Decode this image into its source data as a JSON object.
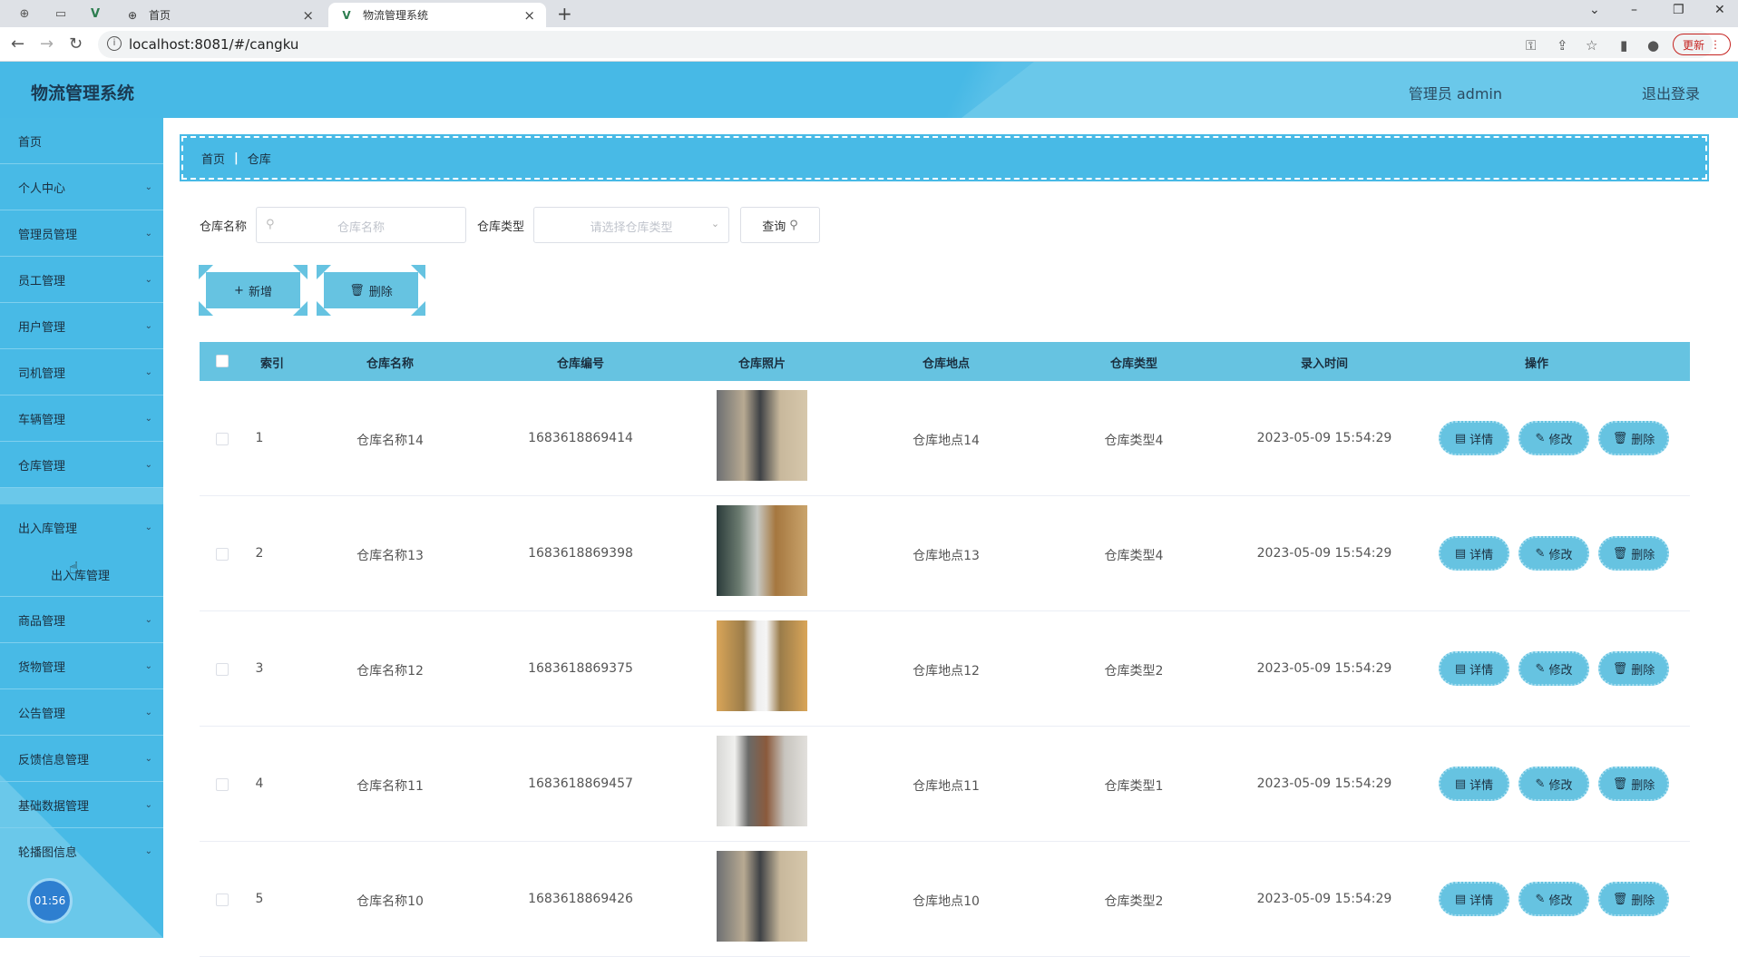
{
  "browser": {
    "tabs": [
      {
        "title": "首页",
        "active": false
      },
      {
        "title": "物流管理系统",
        "active": true
      }
    ],
    "url": "localhost:8081/#/cangku",
    "update_label": "更新"
  },
  "header": {
    "title": "物流管理系统",
    "user_label": "管理员 admin",
    "logout_label": "退出登录"
  },
  "sidebar": {
    "items": [
      {
        "label": "首页"
      },
      {
        "label": "个人中心"
      },
      {
        "label": "管理员管理"
      },
      {
        "label": "员工管理"
      },
      {
        "label": "用户管理"
      },
      {
        "label": "司机管理"
      },
      {
        "label": "车辆管理"
      },
      {
        "label": "仓库管理"
      },
      {
        "label": "出入库管理"
      },
      {
        "label": "商品管理"
      },
      {
        "label": "货物管理"
      },
      {
        "label": "公告管理"
      },
      {
        "label": "反馈信息管理"
      },
      {
        "label": "基础数据管理"
      },
      {
        "label": "轮播图信息"
      }
    ],
    "submenu_label": "出入库管理",
    "clock": "01:56"
  },
  "breadcrumb": {
    "home": "首页",
    "current": "仓库"
  },
  "search": {
    "name_label": "仓库名称",
    "name_placeholder": "仓库名称",
    "type_label": "仓库类型",
    "type_placeholder": "请选择仓库类型",
    "query_label": "查询"
  },
  "actions": {
    "add_label": "新增",
    "delete_label": "删除"
  },
  "table": {
    "headers": [
      "索引",
      "仓库名称",
      "仓库编号",
      "仓库照片",
      "仓库地点",
      "仓库类型",
      "录入时间",
      "操作"
    ],
    "rows": [
      {
        "index": "1",
        "name": "仓库名称14",
        "code": "1683618869414",
        "location": "仓库地点14",
        "type": "仓库类型4",
        "time": "2023-05-09 15:54:29"
      },
      {
        "index": "2",
        "name": "仓库名称13",
        "code": "1683618869398",
        "location": "仓库地点13",
        "type": "仓库类型4",
        "time": "2023-05-09 15:54:29"
      },
      {
        "index": "3",
        "name": "仓库名称12",
        "code": "1683618869375",
        "location": "仓库地点12",
        "type": "仓库类型2",
        "time": "2023-05-09 15:54:29"
      },
      {
        "index": "4",
        "name": "仓库名称11",
        "code": "1683618869457",
        "location": "仓库地点11",
        "type": "仓库类型1",
        "time": "2023-05-09 15:54:29"
      },
      {
        "index": "5",
        "name": "仓库名称10",
        "code": "1683618869426",
        "location": "仓库地点10",
        "type": "仓库类型2",
        "time": "2023-05-09 15:54:29"
      }
    ],
    "op_labels": {
      "detail": "详情",
      "edit": "修改",
      "delete": "删除"
    }
  },
  "colors": {
    "primary": "#48bae6",
    "table_header": "#66c3e1"
  }
}
